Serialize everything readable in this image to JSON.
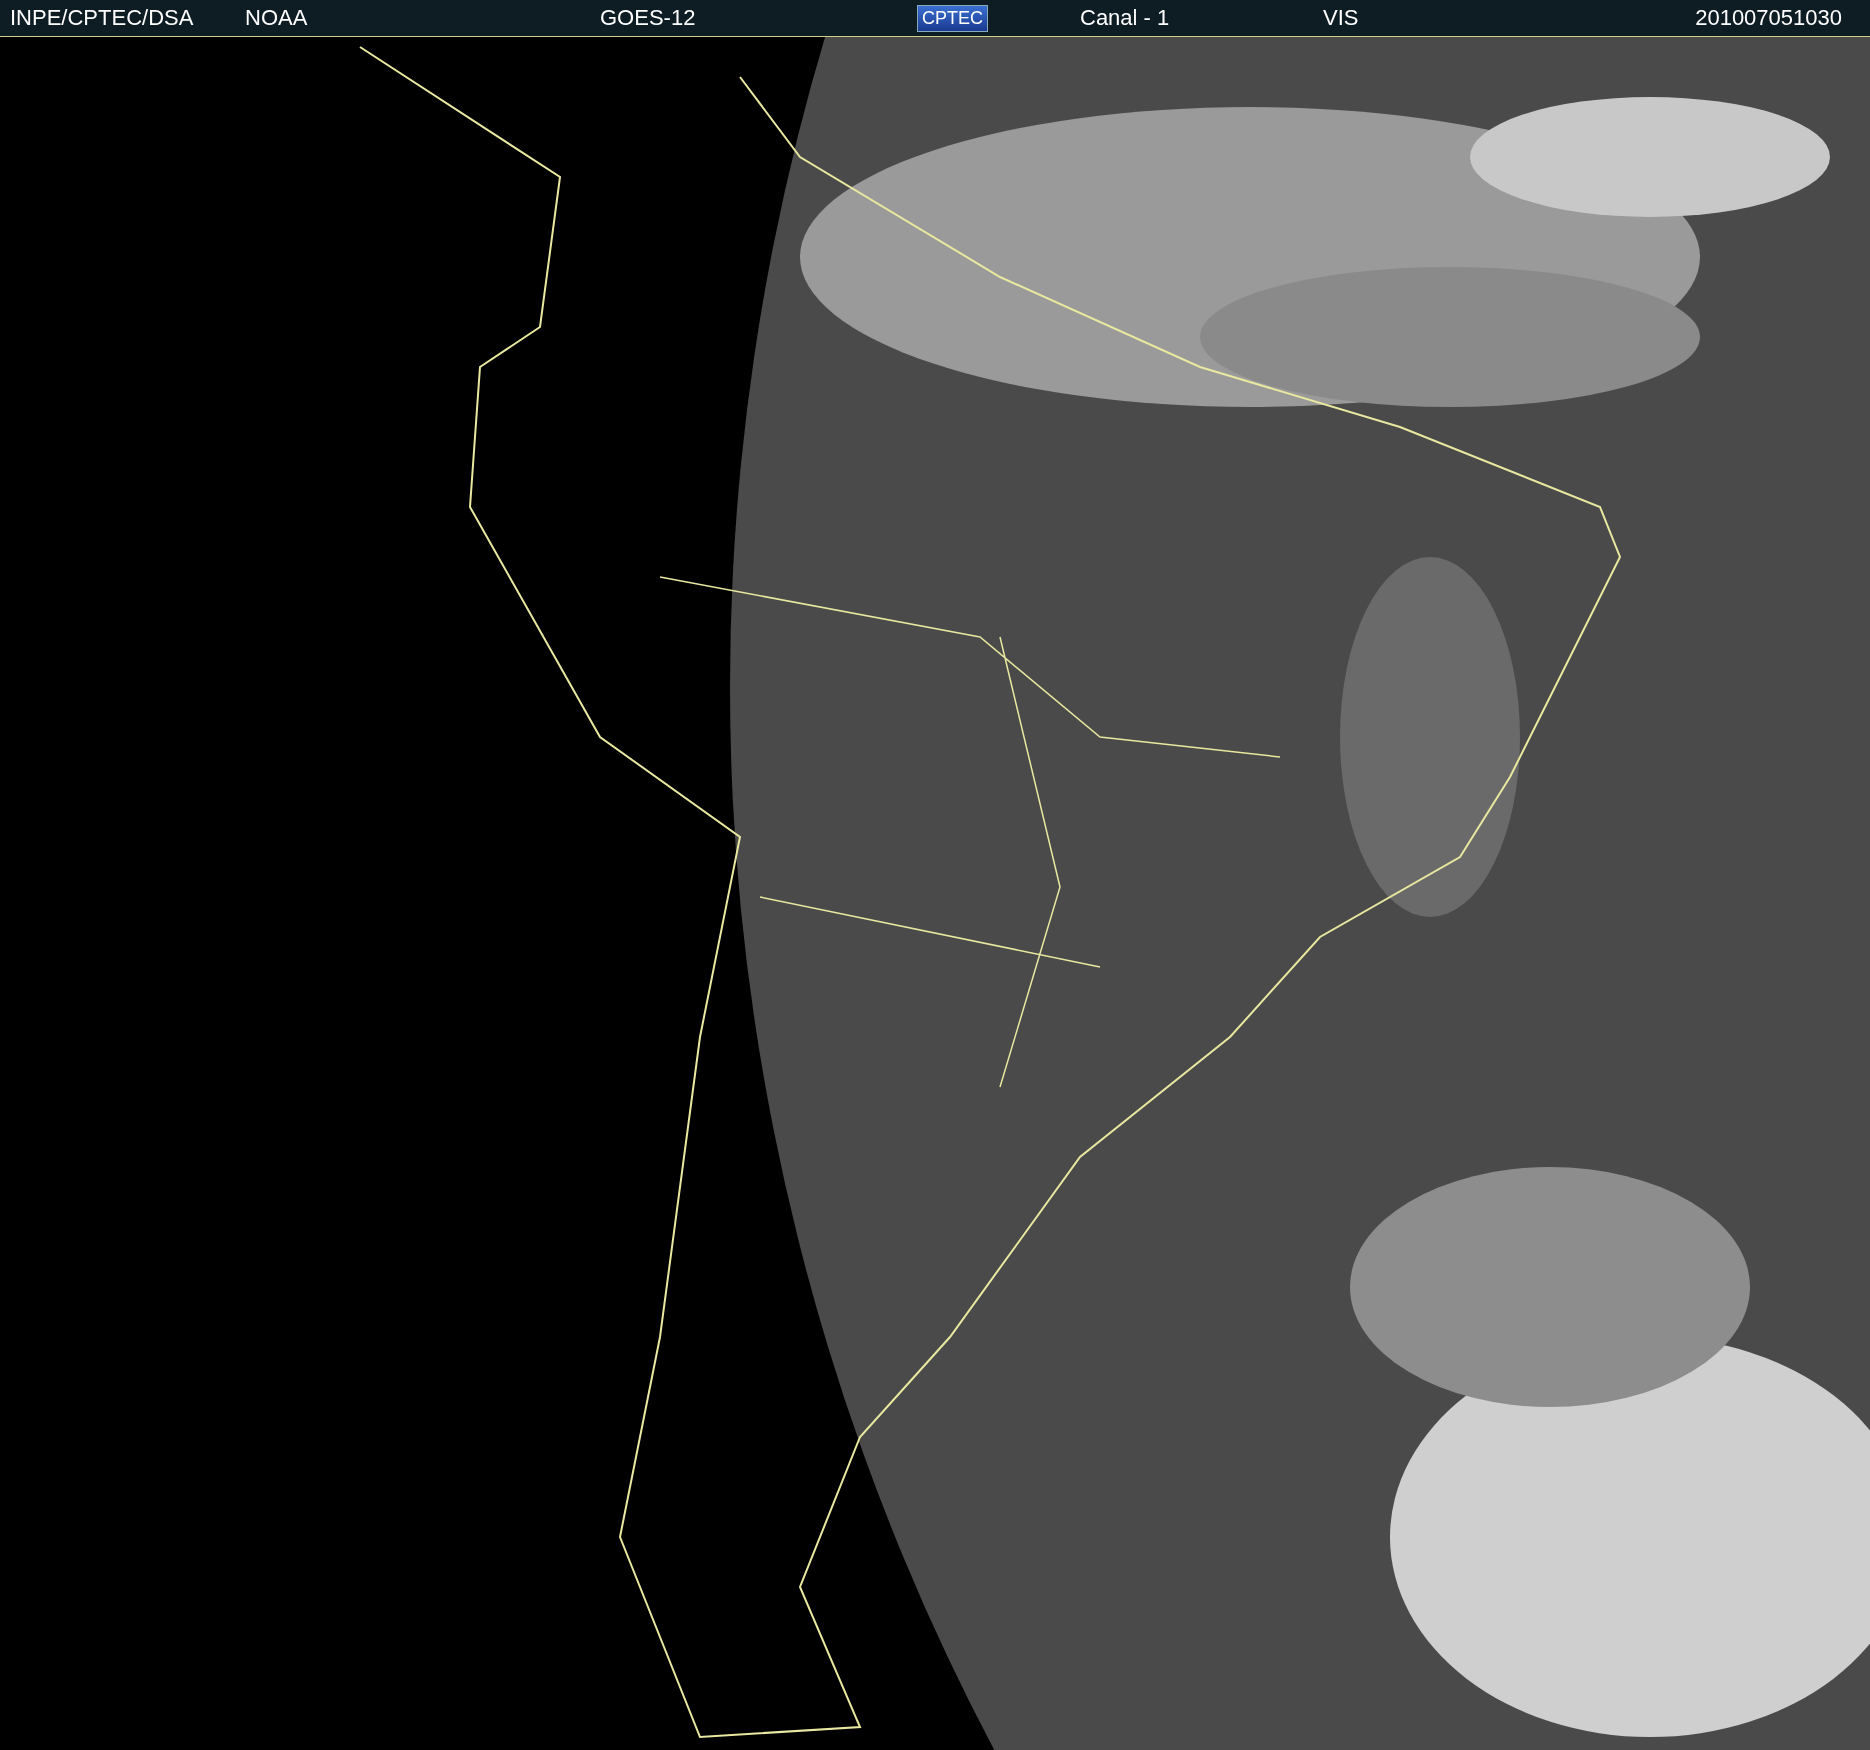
{
  "header": {
    "source": "INPE/CPTEC/DSA",
    "agency": "NOAA",
    "satellite": "GOES-12",
    "logo": "CPTEC",
    "channel": "Canal - 1",
    "band": "VIS",
    "timestamp": "201007051030"
  }
}
